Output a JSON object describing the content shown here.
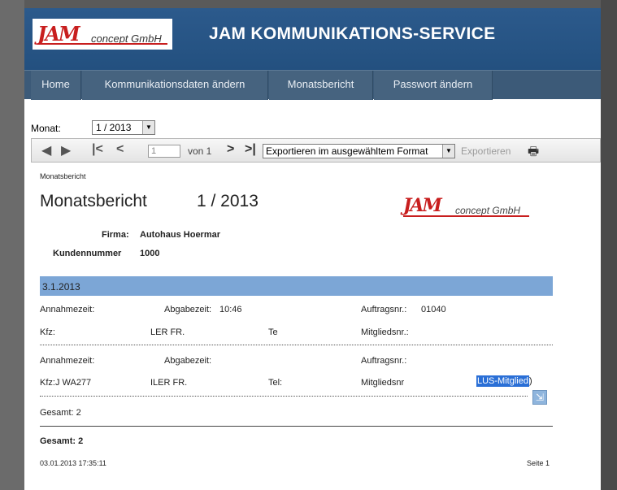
{
  "header": {
    "logo_mark": "JAM",
    "logo_text": "concept GmbH",
    "title": "JAM KOMMUNIKATIONS-SERVICE"
  },
  "nav": {
    "items": [
      {
        "label": "Home"
      },
      {
        "label": "Kommunikationsdaten ändern"
      },
      {
        "label": "Monatsbericht"
      },
      {
        "label": "Passwort ändern"
      }
    ]
  },
  "filter": {
    "monat_label": "Monat:",
    "monat_value": "1 / 2013"
  },
  "toolbar": {
    "page_value": "1",
    "von_label": "von 1",
    "format_value": "Exportieren im ausgewähltem Format",
    "export_label": "Exportieren"
  },
  "report": {
    "breadcrumb": "Monatsbericht",
    "title": "Monatsbericht",
    "period": "1 / 2013",
    "logo_mark": "JAM",
    "logo_text": "concept GmbH",
    "firma_label": "Firma:",
    "firma_value": "Autohaus Hoermar",
    "kundennummer_label": "Kundennummer",
    "kundennummer_value": "1000",
    "date_band": "3.1.2013",
    "entries": [
      {
        "annahme_label": "Annahmezeit:",
        "abgabe_label": "Abgabezeit:",
        "abgabe_value": "10:46",
        "auftrag_label": "Auftragsnr.:",
        "auftrag_value": "01040",
        "kfz_label": "Kfz:",
        "name_value": "LER FR.",
        "tel_label": "Te",
        "mitglied_label": "Mitgliedsnr.:",
        "mitglied_value": ""
      },
      {
        "annahme_label": "Annahmezeit:",
        "abgabe_label": "Abgabezeit:",
        "abgabe_value": "",
        "auftrag_label": "Auftragsnr.:",
        "auftrag_value": "",
        "kfz_label": "Kfz:J WA277",
        "name_value": "ILER FR.",
        "tel_label": "Tel:",
        "mitglied_label": "Mitgliedsnr",
        "mitglied_value": "LUS-Mitglied",
        "mitglied_suffix": ")"
      }
    ],
    "subtotal": "Gesamt: 2",
    "total": "Gesamt: 2",
    "timestamp": "03.01.2013 17:35:11",
    "page_label": "Seite 1"
  }
}
